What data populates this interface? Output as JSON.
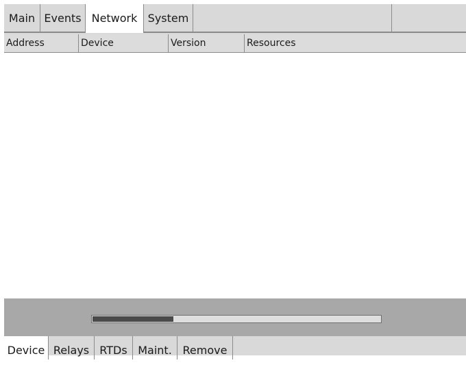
{
  "top_tabs": [
    {
      "label": "Main"
    },
    {
      "label": "Events"
    },
    {
      "label": "Network"
    },
    {
      "label": "System"
    }
  ],
  "active_top_tab": "Network",
  "table": {
    "columns": [
      "Address",
      "Device",
      "Version",
      "Resources"
    ],
    "rows": []
  },
  "progress": {
    "fraction": 0.28
  },
  "bottom_tabs": [
    {
      "label": "Device"
    },
    {
      "label": "Relays"
    },
    {
      "label": "RTDs"
    },
    {
      "label": "Maint."
    },
    {
      "label": "Remove"
    }
  ],
  "active_bottom_tab": "Device",
  "colors": {
    "background": "#d9d9d9",
    "active_tab": "#ffffff",
    "progress_fill": "#4a4a4a"
  }
}
